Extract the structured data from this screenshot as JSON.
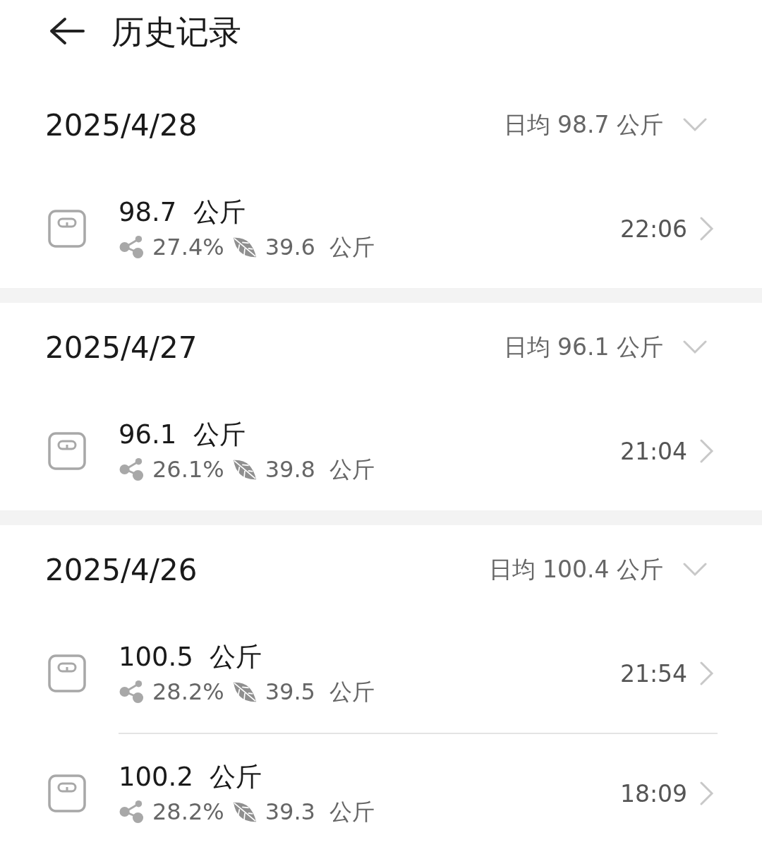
{
  "header": {
    "title": "历史记录"
  },
  "days": [
    {
      "date": "2025/4/28",
      "average": "日均 98.7 公斤",
      "records": [
        {
          "weight": "98.7  公斤",
          "fat": "27.4%",
          "muscle": "39.6  公斤",
          "time": "22:06"
        }
      ]
    },
    {
      "date": "2025/4/27",
      "average": "日均 96.1 公斤",
      "records": [
        {
          "weight": "96.1  公斤",
          "fat": "26.1%",
          "muscle": "39.8  公斤",
          "time": "21:04"
        }
      ]
    },
    {
      "date": "2025/4/26",
      "average": "日均 100.4 公斤",
      "records": [
        {
          "weight": "100.5  公斤",
          "fat": "28.2%",
          "muscle": "39.5  公斤",
          "time": "21:54"
        },
        {
          "weight": "100.2  公斤",
          "fat": "28.2%",
          "muscle": "39.3  公斤",
          "time": "18:09"
        }
      ]
    }
  ]
}
